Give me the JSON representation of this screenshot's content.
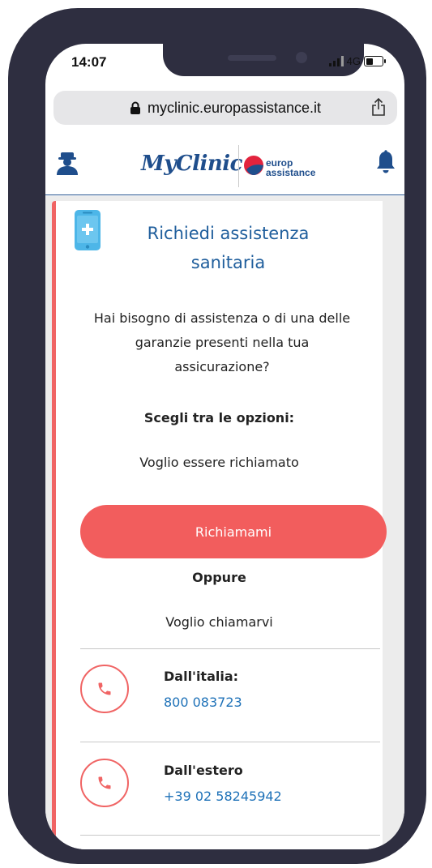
{
  "status_bar": {
    "time": "14:07",
    "network": "4G"
  },
  "browser": {
    "url": "myclinic.europassistance.it"
  },
  "header": {
    "brand_name": "MyClinic",
    "partner_line1": "europ",
    "partner_line2": "assistance"
  },
  "card": {
    "title": "Richiedi assistenza sanitaria",
    "intro": "Hai bisogno di assistenza o di una delle garanzie presenti nella tua assicurazione?",
    "choose_label": "Scegli tra le opzioni:",
    "callback_text": "Voglio essere richiamato",
    "callback_button": "Richiamami",
    "or_label": "Oppure",
    "call_us_text": "Voglio chiamarvi",
    "contacts": [
      {
        "label": "Dall'italia:",
        "number": "800 083723"
      },
      {
        "label": "Dall'estero",
        "number": "+39 02 58245942"
      }
    ]
  },
  "colors": {
    "brand_blue": "#1f4e8c",
    "title_blue": "#1f5e9c",
    "link_blue": "#1f72b8",
    "accent_red": "#f25d5d",
    "phone_frame": "#2e2e40"
  },
  "icons": [
    "lock-icon",
    "share-icon",
    "profile-icon",
    "bell-icon",
    "mobile-medical-icon",
    "phone-icon"
  ]
}
